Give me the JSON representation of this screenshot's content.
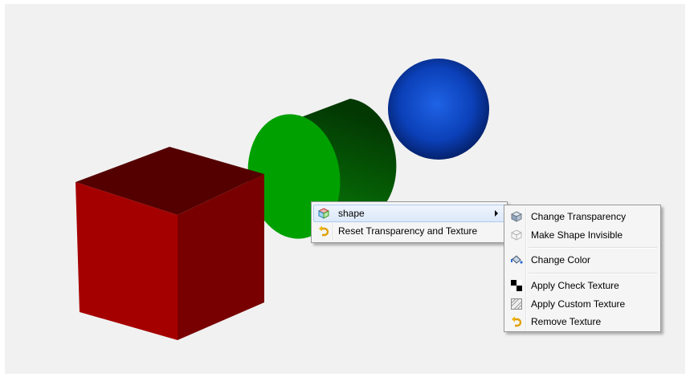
{
  "scene": {
    "objects": [
      {
        "name": "cube",
        "color": "#a00000"
      },
      {
        "name": "cylinder",
        "color": "#009900"
      },
      {
        "name": "sphere",
        "color": "#0a3fb8"
      }
    ]
  },
  "context_menu": {
    "items": [
      {
        "label": "shape",
        "icon": "shape-icon",
        "has_submenu": true,
        "highlighted": true
      },
      {
        "label": "Reset Transparency and Texture",
        "icon": "undo-icon"
      }
    ]
  },
  "submenu": {
    "items": [
      {
        "label": "Change Transparency",
        "icon": "transparency-cube-icon"
      },
      {
        "label": "Make Shape Invisible",
        "icon": "invisible-cube-icon"
      },
      {
        "label": "Change Color",
        "icon": "paint-bucket-icon"
      },
      {
        "label": "Apply Check Texture",
        "icon": "checker-icon"
      },
      {
        "label": "Apply Custom Texture",
        "icon": "custom-texture-icon"
      },
      {
        "label": "Remove Texture",
        "icon": "undo-icon"
      }
    ]
  }
}
